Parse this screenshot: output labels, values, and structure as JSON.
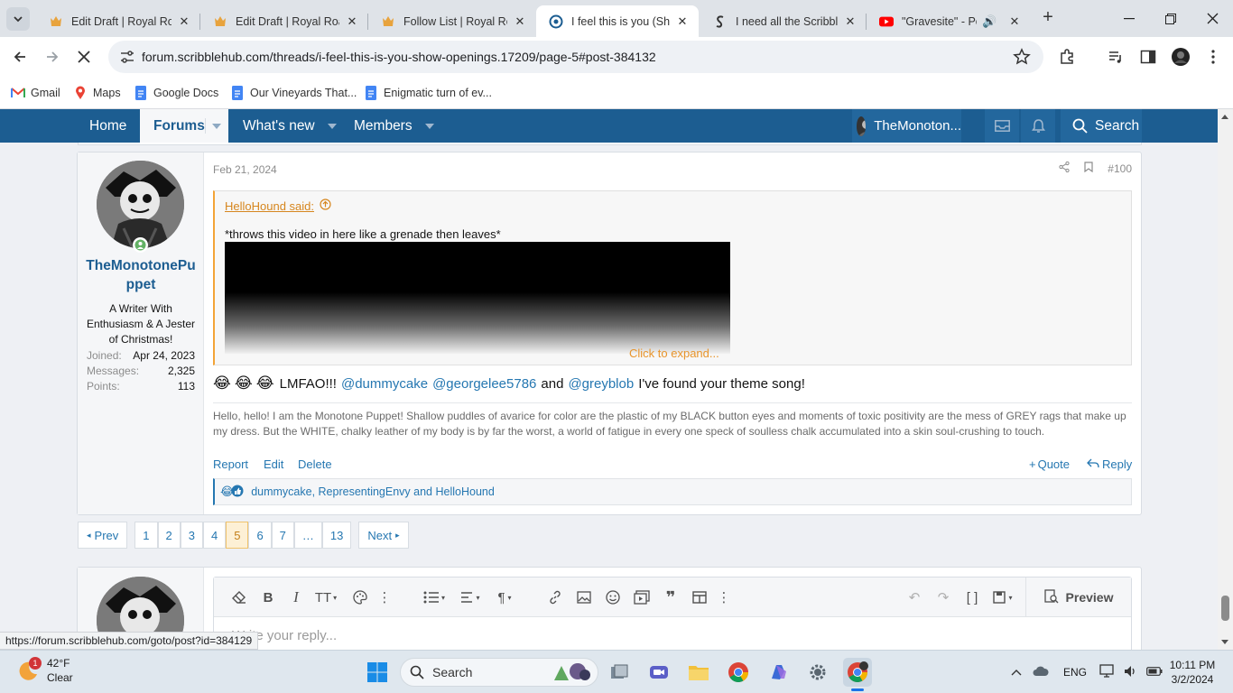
{
  "browser": {
    "tabs": [
      {
        "title": "Edit Draft | Royal Roa",
        "icon": "royalroad-icon",
        "active": false
      },
      {
        "title": "Edit Draft | Royal Roa",
        "icon": "royalroad-icon",
        "active": false
      },
      {
        "title": "Follow List | Royal Ro",
        "icon": "royalroad-icon",
        "active": false
      },
      {
        "title": "I feel this is you (Sho",
        "icon": "scribblehub-icon",
        "active": true
      },
      {
        "title": "I need all the Scribble",
        "icon": "scribblehub-icon",
        "active": false
      },
      {
        "title": "\"Gravesite\" - Pop",
        "icon": "youtube-icon",
        "active": false
      }
    ],
    "url": "forum.scribblehub.com/threads/i-feel-this-is-you-show-openings.17209/page-5#post-384132",
    "bookmarks": [
      {
        "label": "Gmail",
        "icon": "gmail-icon"
      },
      {
        "label": "Maps",
        "icon": "maps-icon"
      },
      {
        "label": "Google Docs",
        "icon": "docs-icon"
      },
      {
        "label": "Our Vineyards That...",
        "icon": "docs-icon"
      },
      {
        "label": "Enigmatic turn of ev...",
        "icon": "docs-icon"
      }
    ],
    "status_url": "https://forum.scribblehub.com/goto/post?id=384129"
  },
  "nav": {
    "home": "Home",
    "forums": "Forums",
    "whats_new": "What's new",
    "members": "Members",
    "user": "TheMonoton...",
    "search": "Search"
  },
  "post": {
    "date": "Feb 21, 2024",
    "number": "#100",
    "author": {
      "name": "TheMonotonePuppet",
      "title": "A Writer With Enthusiasm & A Jester of Christmas!",
      "stats": [
        {
          "label": "Joined:",
          "value": "Apr 24, 2023"
        },
        {
          "label": "Messages:",
          "value": "2,325"
        },
        {
          "label": "Points:",
          "value": "113"
        }
      ]
    },
    "quote": {
      "author": "HelloHound said:",
      "text": "*throws this video in here like a grenade then leaves*",
      "expand": "Click to expand..."
    },
    "body": {
      "emojis": [
        "😂",
        "😂",
        "😂"
      ],
      "lead": "LMFAO!!!",
      "mention1": "@dummycake",
      "mention2": "@georgelee5786",
      "and": "and",
      "mention3": "@greyblob",
      "tail": "I've found your theme song!"
    },
    "signature": "Hello, hello! I am the Monotone Puppet! Shallow puddles of avarice for color are the plastic of my BLACK button eyes and moments of toxic positivity are the mess of GREY rags that make up my dress. But the WHITE, chalky leather of my body is by far the worst, a world of fatigue in every one speck of soulless chalk accumulated into a skin soul-crushing to touch.",
    "actions": {
      "report": "Report",
      "edit": "Edit",
      "delete": "Delete",
      "quote": "Quote",
      "reply": "Reply"
    },
    "reactions": "dummycake, RepresentingEnvy and HelloHound"
  },
  "pagination": {
    "prev": "Prev",
    "pages": [
      "1",
      "2",
      "3",
      "4",
      "5",
      "6",
      "7",
      "…",
      "13"
    ],
    "current": "5",
    "next": "Next"
  },
  "editor": {
    "placeholder": "Write your reply...",
    "preview": "Preview"
  },
  "taskbar": {
    "weather_temp": "42°F",
    "weather_desc": "Clear",
    "weather_badge": "1",
    "search": "Search",
    "lang": "ENG",
    "time": "10:11 PM",
    "date": "3/2/2024"
  }
}
